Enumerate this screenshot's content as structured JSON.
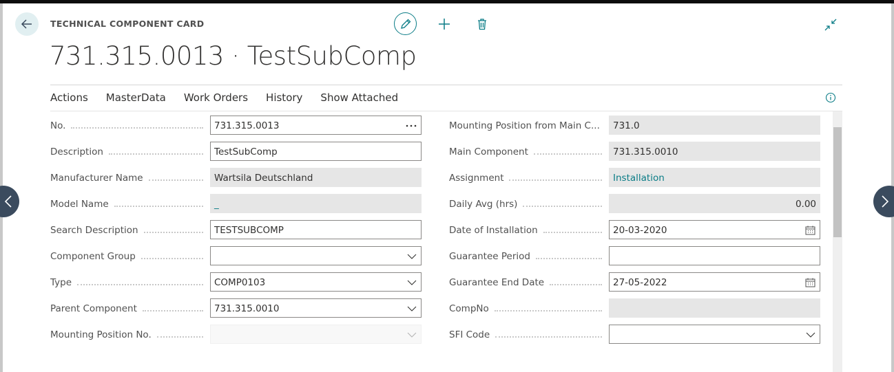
{
  "header": {
    "page_kind": "TECHNICAL COMPONENT CARD",
    "title": "731.315.0013 · TestSubComp"
  },
  "toolbar": {
    "edit_icon": "pencil-icon",
    "add_icon": "plus-icon",
    "delete_icon": "trash-icon",
    "collapse_icon": "collapse-icon"
  },
  "menu": {
    "items": [
      "Actions",
      "MasterData",
      "Work Orders",
      "History",
      "Show Attached"
    ]
  },
  "left_fields": [
    {
      "label": "No.",
      "value": "731.315.0013",
      "kind": "input",
      "icon": "ellipsis"
    },
    {
      "label": "Description",
      "value": "TestSubComp",
      "kind": "input"
    },
    {
      "label": "Manufacturer Name",
      "value": "Wartsila Deutschland",
      "kind": "readonly"
    },
    {
      "label": "Model Name",
      "value": "_",
      "kind": "readonly-link"
    },
    {
      "label": "Search Description",
      "value": "TESTSUBCOMP",
      "kind": "input"
    },
    {
      "label": "Component Group",
      "value": "",
      "kind": "select"
    },
    {
      "label": "Type",
      "value": "COMP0103",
      "kind": "select"
    },
    {
      "label": "Parent Component",
      "value": "731.315.0010",
      "kind": "select"
    },
    {
      "label": "Mounting Position No.",
      "value": "",
      "kind": "select-disabled"
    }
  ],
  "right_fields": [
    {
      "label": "Mounting Position from Main C...",
      "value": "731.0",
      "kind": "readonly"
    },
    {
      "label": "Main Component",
      "value": "731.315.0010",
      "kind": "readonly"
    },
    {
      "label": "Assignment",
      "value": "Installation",
      "kind": "readonly-link"
    },
    {
      "label": "Daily Avg (hrs)",
      "value": "0.00",
      "kind": "readonly-num"
    },
    {
      "label": "Date of Installation",
      "value": "20-03-2020",
      "kind": "date"
    },
    {
      "label": "Guarantee Period",
      "value": "",
      "kind": "input"
    },
    {
      "label": "Guarantee End Date",
      "value": "27-05-2022",
      "kind": "date"
    },
    {
      "label": "CompNo",
      "value": "",
      "kind": "readonly"
    },
    {
      "label": "SFI Code",
      "value": "",
      "kind": "select"
    }
  ]
}
